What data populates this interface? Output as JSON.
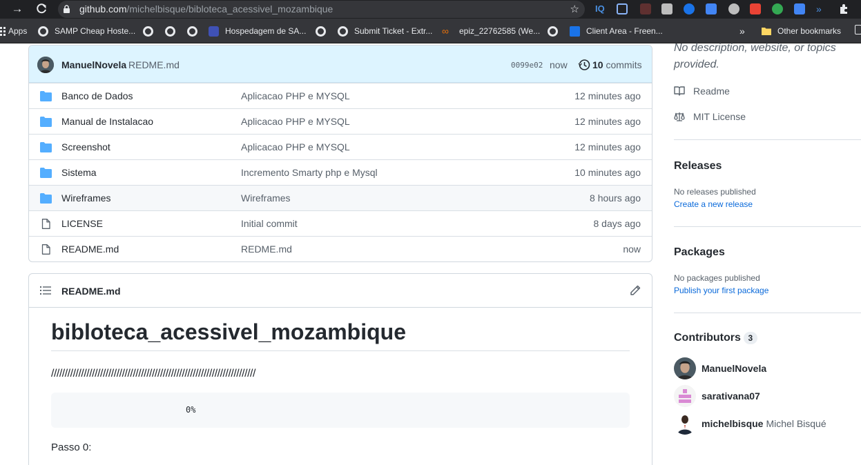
{
  "browser": {
    "url_host": "github.com",
    "url_path": "/michelbisque/bibloteca_acessivel_mozambique",
    "bookmarks": [
      {
        "label": "Apps",
        "icon": "apps-grid-icon"
      },
      {
        "label": "SAMP Cheap Hoste...",
        "icon": "globe-icon"
      },
      {
        "label": "",
        "icon": "globe-icon"
      },
      {
        "label": "",
        "icon": "globe-icon"
      },
      {
        "label": "Hospedagem de SA...",
        "icon": "bookmark-favicon-icon"
      },
      {
        "label": "",
        "icon": "globe-icon"
      },
      {
        "label": "Submit Ticket - Extr...",
        "icon": "globe-icon"
      },
      {
        "label": "epiz_22762585 (We...",
        "icon": "infinity-icon"
      },
      {
        "label": "",
        "icon": "globe-icon"
      },
      {
        "label": "Client Area - Freen...",
        "icon": "freenom-icon"
      }
    ],
    "more_bookmarks": "»",
    "other_bookmarks": "Other bookmarks"
  },
  "repo": {
    "latest_commit": {
      "author": "ManuelNovela",
      "message": "REDME.md",
      "hash": "0099e02",
      "time": "now",
      "commits_count": "10",
      "commits_label": "commits"
    },
    "files": [
      {
        "type": "folder",
        "name": "Banco de Dados",
        "message": "Aplicacao PHP e MYSQL",
        "time": "12 minutes ago"
      },
      {
        "type": "folder",
        "name": "Manual de Instalacao",
        "message": "Aplicacao PHP e MYSQL",
        "time": "12 minutes ago"
      },
      {
        "type": "folder",
        "name": "Screenshot",
        "message": "Aplicacao PHP e MYSQL",
        "time": "12 minutes ago"
      },
      {
        "type": "folder",
        "name": "Sistema",
        "message": "Incremento Smarty php e Mysql",
        "time": "10 minutes ago"
      },
      {
        "type": "folder",
        "name": "Wireframes",
        "message": "Wireframes",
        "time": "8 hours ago"
      },
      {
        "type": "file",
        "name": "LICENSE",
        "message": "Initial commit",
        "time": "8 days ago"
      },
      {
        "type": "file",
        "name": "README.md",
        "message": "REDME.md",
        "time": "now"
      }
    ],
    "highlighted_row": 4
  },
  "readme": {
    "title": "README.md",
    "heading": "bibloteca_acessivel_mozambique",
    "slashes": "///////////////////////////////////////////////////////////////////////////",
    "code": "0%",
    "step": "Passo 0:"
  },
  "sidebar": {
    "about": "No description, website, or topics provided.",
    "readme_link": "Readme",
    "license_link": "MIT License",
    "releases": {
      "title": "Releases",
      "empty": "No releases published",
      "action": "Create a new release"
    },
    "packages": {
      "title": "Packages",
      "empty": "No packages published",
      "action": "Publish your first package"
    },
    "contributors": {
      "title": "Contributors",
      "count": "3",
      "people": [
        {
          "login": "ManuelNovela",
          "full_name": ""
        },
        {
          "login": "sarativana07",
          "full_name": ""
        },
        {
          "login": "michelbisque",
          "full_name": "Michel Bisqué"
        }
      ]
    }
  },
  "colors": {
    "folder": "#54aeff",
    "link": "#0969da",
    "commit_bar": "#ddf4ff"
  }
}
